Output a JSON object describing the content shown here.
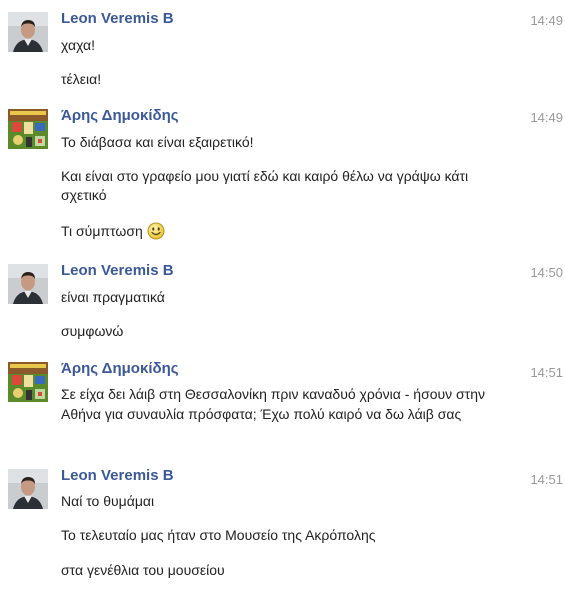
{
  "conversation": {
    "groups": [
      {
        "sender": "Leon Veremis B",
        "avatar": "profile-photo-man",
        "time": "14:49",
        "messages": [
          "χαχα!",
          "τέλεια!"
        ]
      },
      {
        "sender": "Άρης Δημοκίδης",
        "avatar": "profile-photo-colorful-collage",
        "time": "14:49",
        "messages": [
          "Το διάβασα και είναι εξαιρετικό!",
          "Και είναι στο γραφείο μου γιατί εδώ και καιρό θέλω να γράψω κάτι σχετικό",
          "Τι σύμπτωση"
        ],
        "emoticon": "smiley-face-icon"
      },
      {
        "sender": "Leon Veremis B",
        "avatar": "profile-photo-man",
        "time": "14:50",
        "messages": [
          "είναι πραγματικά",
          "συμφωνώ"
        ]
      },
      {
        "sender": "Άρης Δημοκίδης",
        "avatar": "profile-photo-colorful-collage",
        "time": "14:51",
        "messages": [
          "Σε είχα δει λάιβ στη Θεσσαλονίκη πριν καναδυό χρόνια - ήσουν στην Αθήνα για συναυλία πρόσφατα; Έχω πολύ καιρό να δω λάιβ σας"
        ]
      },
      {
        "sender": "Leon Veremis B",
        "avatar": "profile-photo-man",
        "time": "14:51",
        "messages": [
          "Ναί το θυμάμαι",
          "Το τελευταίο μας ήταν στο Μουσείο της Ακρόπολης",
          "στα γενέθλια του μουσείου"
        ]
      }
    ]
  },
  "colors": {
    "sender_name": "#3b5998",
    "timestamp": "#999999",
    "message_text": "#222222",
    "background": "#ffffff"
  }
}
